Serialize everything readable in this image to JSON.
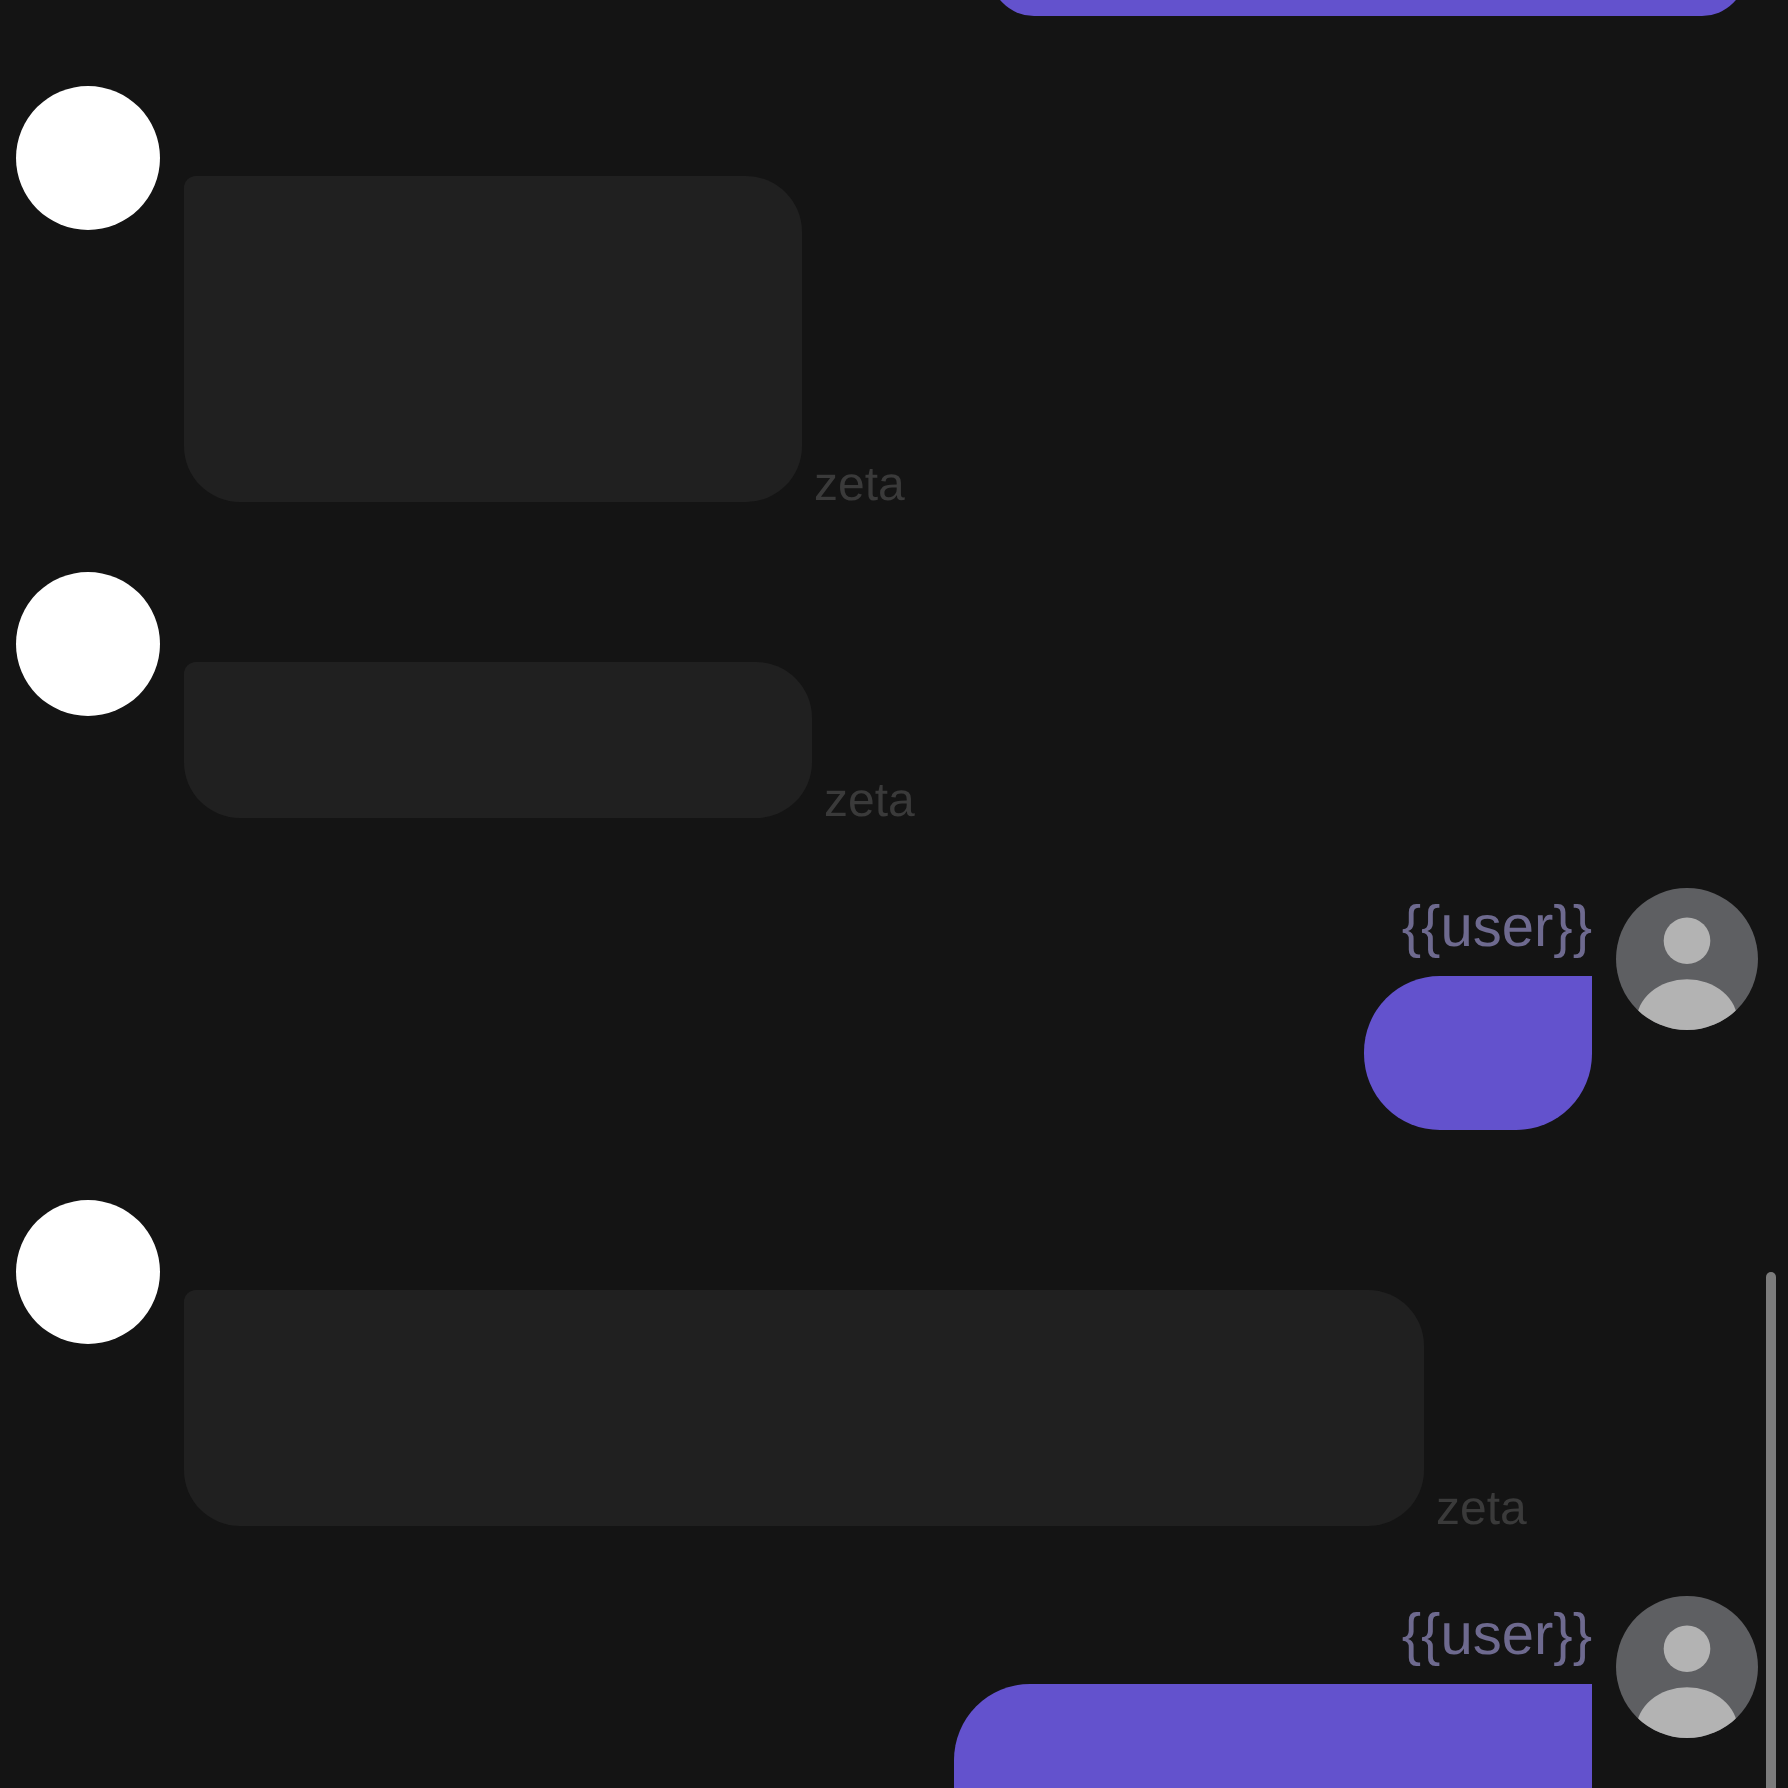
{
  "chat": {
    "messages": [
      {
        "kind": "user"
      },
      {
        "kind": "bot",
        "sender": "zeta"
      },
      {
        "kind": "bot",
        "sender": "zeta"
      },
      {
        "kind": "user",
        "sender": "{{user}}"
      },
      {
        "kind": "bot",
        "sender": "zeta"
      },
      {
        "kind": "user",
        "sender": "{{user}}"
      }
    ]
  }
}
